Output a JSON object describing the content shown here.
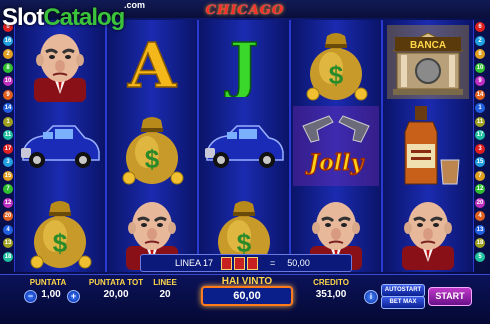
{
  "logo": {
    "slot": "Slot",
    "catalog": "Catalog",
    "com": ".com"
  },
  "game": {
    "title": "CHICAGO"
  },
  "paylines_left": [
    6,
    16,
    2,
    8,
    10,
    9,
    14,
    1,
    11,
    17,
    3,
    15,
    7,
    12,
    20,
    4,
    13,
    18
  ],
  "paylines_right": [
    6,
    2,
    8,
    10,
    9,
    14,
    1,
    11,
    17,
    3,
    15,
    7,
    12,
    20,
    4,
    13,
    18,
    5
  ],
  "reels": [
    [
      "gangster-boss",
      "blue-car",
      "money-bag"
    ],
    [
      "letter-a",
      "money-bag",
      "gangster-boss"
    ],
    [
      "letter-j",
      "blue-car",
      "money-bag"
    ],
    [
      "money-bag",
      "jolly-guns",
      "gangster-boss"
    ],
    [
      "banca",
      "whiskey",
      "gangster-boss"
    ]
  ],
  "symbols": {
    "banca_label": "BANCA",
    "jolly_label": "Jolly",
    "letter_a": "A",
    "letter_j": "J"
  },
  "win_line": {
    "label": "LINEA 17",
    "equals": "=",
    "amount": "50,00"
  },
  "controls": {
    "puntata_label": "PUNTATA",
    "puntata_value": "1,00",
    "minus": "−",
    "plus": "+",
    "puntata_tot_label": "PUNTATA TOT",
    "puntata_tot_value": "20,00",
    "linee_label": "LINEE",
    "linee_value": "20",
    "hai_vinto_label": "HAI VINTO",
    "hai_vinto_value": "60,00",
    "credito_label": "CREDITO",
    "credito_value": "351,00",
    "info": "i",
    "autostart": "AUTOSTART",
    "bet_max": "BET MAX",
    "start": "START"
  },
  "colors": {
    "accent_gold": "#ffd84a",
    "title_red": "#ff2b2b",
    "panel_blue": "#0a1f8a",
    "start_purple": "#c03ac8"
  }
}
